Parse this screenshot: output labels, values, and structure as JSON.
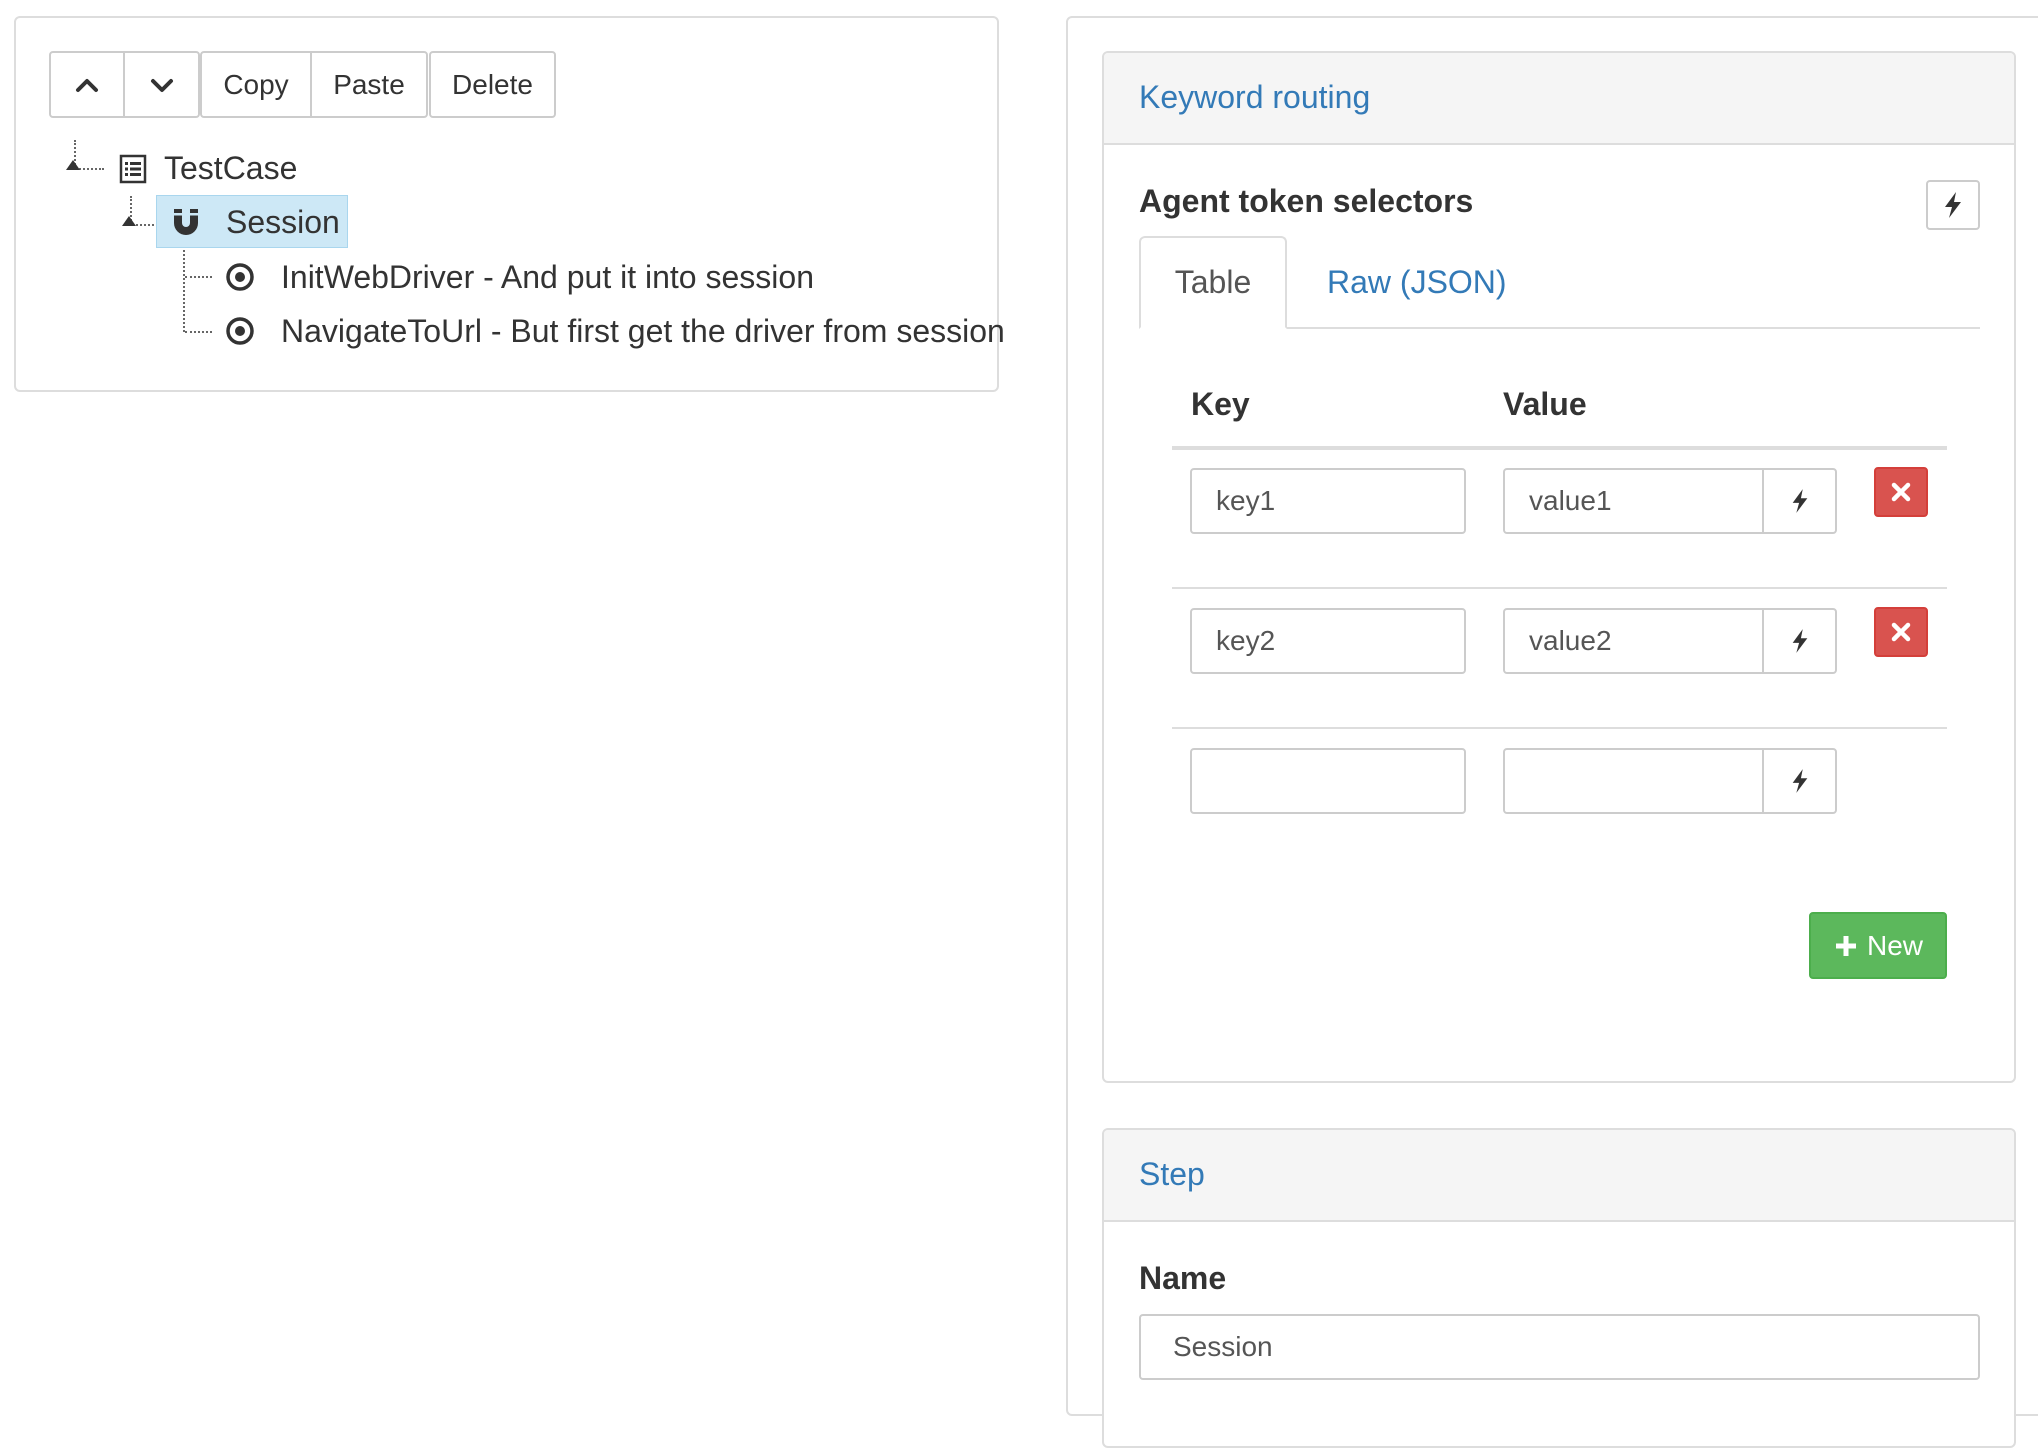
{
  "toolbar": {
    "up_icon": "chevron-up-icon",
    "down_icon": "chevron-down-icon",
    "copy_label": "Copy",
    "paste_label": "Paste",
    "delete_label": "Delete"
  },
  "tree": {
    "root": {
      "label": "TestCase",
      "icon": "list-icon"
    },
    "child": {
      "label": "Session",
      "icon": "magnet-icon",
      "selected": true
    },
    "leaves": [
      {
        "label": "InitWebDriver - And put it into session",
        "icon": "dot-circle-icon"
      },
      {
        "label": "NavigateToUrl - But first get the driver from session",
        "icon": "dot-circle-icon"
      }
    ]
  },
  "keyword_routing": {
    "title": "Keyword routing",
    "section_title": "Agent token selectors",
    "tabs": [
      {
        "label": "Table",
        "active": true
      },
      {
        "label": "Raw (JSON)",
        "active": false
      }
    ],
    "columns": [
      "Key",
      "Value"
    ],
    "rows": [
      {
        "key": "key1",
        "value": "value1"
      },
      {
        "key": "key2",
        "value": "value2"
      },
      {
        "key": "",
        "value": ""
      }
    ],
    "new_label": "New"
  },
  "step": {
    "title": "Step",
    "name_label": "Name",
    "name_value": "Session"
  },
  "colors": {
    "link": "#337ab7",
    "danger": "#d9534f",
    "success": "#5cb85c",
    "selection": "#cde8f6"
  }
}
